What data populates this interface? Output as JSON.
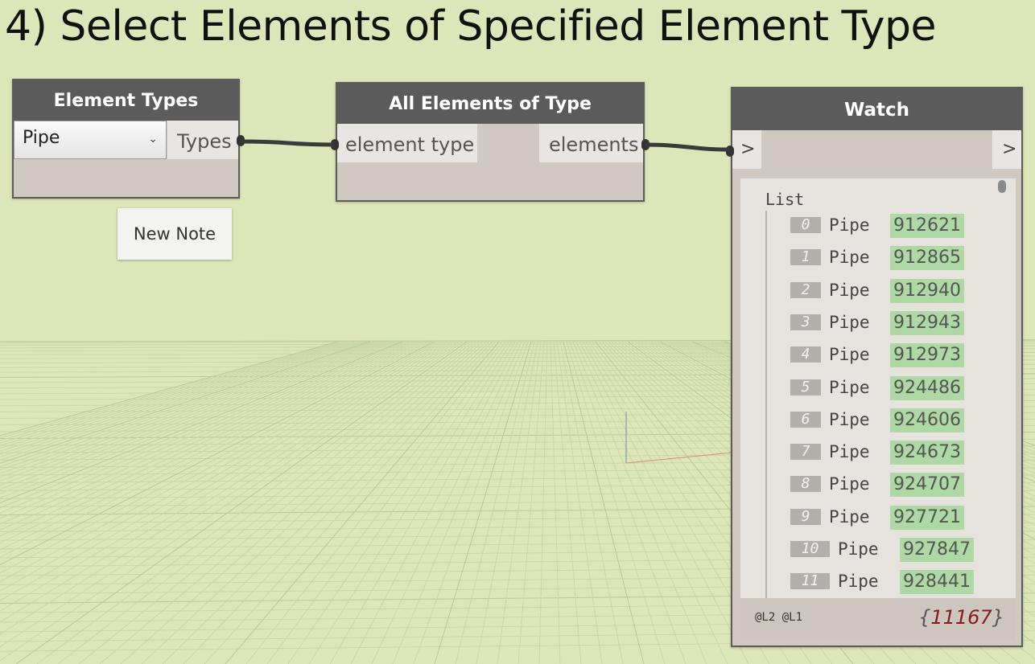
{
  "title": "4) Select Elements of Specified Element Type",
  "element_types_node": {
    "header": "Element Types",
    "selected": "Pipe",
    "output_port": "Types"
  },
  "all_elements_node": {
    "header": "All Elements of Type",
    "input_port": "element type",
    "output_port": "elements"
  },
  "watch_node": {
    "header": "Watch",
    "input_port": ">",
    "output_port": ">",
    "list_label": "List",
    "items": [
      {
        "index": "0",
        "type": "Pipe",
        "id": "912621"
      },
      {
        "index": "1",
        "type": "Pipe",
        "id": "912865"
      },
      {
        "index": "2",
        "type": "Pipe",
        "id": "912940"
      },
      {
        "index": "3",
        "type": "Pipe",
        "id": "912943"
      },
      {
        "index": "4",
        "type": "Pipe",
        "id": "912973"
      },
      {
        "index": "5",
        "type": "Pipe",
        "id": "924486"
      },
      {
        "index": "6",
        "type": "Pipe",
        "id": "924606"
      },
      {
        "index": "7",
        "type": "Pipe",
        "id": "924673"
      },
      {
        "index": "8",
        "type": "Pipe",
        "id": "924707"
      },
      {
        "index": "9",
        "type": "Pipe",
        "id": "927721"
      },
      {
        "index": "10",
        "type": "Pipe",
        "id": "927847"
      },
      {
        "index": "11",
        "type": "Pipe",
        "id": "928441"
      }
    ],
    "levels": "@L2 @L1",
    "count_open": "{",
    "count": "11167",
    "count_close": "}"
  },
  "note": {
    "text": "New Note"
  },
  "colors": {
    "canvas": "#dde6b8",
    "node_header": "#5b5b5b",
    "node_body": "#cfc9c2",
    "value_highlight": "#aed9a4",
    "count_text": "#8b1a1a"
  }
}
